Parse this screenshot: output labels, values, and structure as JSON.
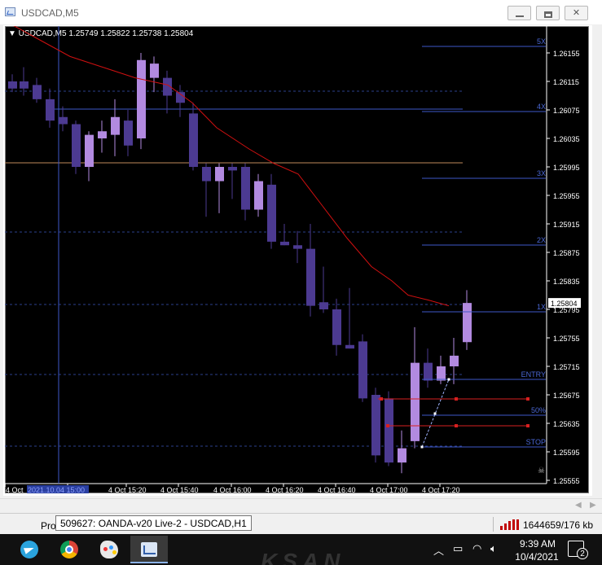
{
  "window": {
    "title": "USDCAD,M5",
    "minimize_icon": "minimize-icon",
    "maximize_icon": "maximize-icon",
    "close_icon": "close-icon"
  },
  "chart": {
    "header": "▼ USDCAD,M5  1.25749 1.25822 1.25738 1.25804",
    "symbol": "USDCAD,M5",
    "current_price": "1.25804",
    "price_tick_labels": [
      "1.26155",
      "1.26115",
      "1.26075",
      "1.26035",
      "1.25995",
      "1.25955",
      "1.25915",
      "1.25875",
      "1.25835",
      "1.25795",
      "1.25755",
      "1.25715",
      "1.25675",
      "1.25635",
      "1.25595",
      "1.25555"
    ],
    "time_tick_labels": [
      "4 Oct",
      "4 Oct 15:00",
      "4 Oct 15:20",
      "4 Oct 15:40",
      "4 Oct 16:00",
      "4 Oct 16:20",
      "4 Oct 16:40",
      "4 Oct 17:00",
      "4 Oct 17:20"
    ],
    "crosshair_time_label": "2021.10.04 15:00",
    "level_labels": [
      "5X",
      "4X",
      "3X",
      "2X",
      "1X",
      "ENTRY",
      "50%",
      "STOP"
    ],
    "colors": {
      "background": "#000000",
      "bull_candle": "#b28ae0",
      "bear_candle": "#4c3a91",
      "moving_average": "#d01010",
      "level_line": "#3e58c8",
      "level_text": "#4a67d4",
      "dashed_level": "#2c3f8c",
      "horizontal_line_orange": "#c08a5a",
      "trade_line_red": "#d82020",
      "axis_text": "#ffffff"
    }
  },
  "statusbar": {
    "profile_text": "Pro",
    "tooltip": "509627: OANDA-v20 Live-2 - USDCAD,H1",
    "connection": "1644659/176 kb"
  },
  "taskbar": {
    "apps": [
      "telegram-icon",
      "chrome-icon",
      "paint-icon",
      "metatrader-icon"
    ],
    "tray_icons": [
      "chevron-up-icon",
      "battery-icon",
      "wifi-icon",
      "volume-icon"
    ],
    "time": "9:39 AM",
    "date": "10/4/2021",
    "notification_count": "2"
  }
}
